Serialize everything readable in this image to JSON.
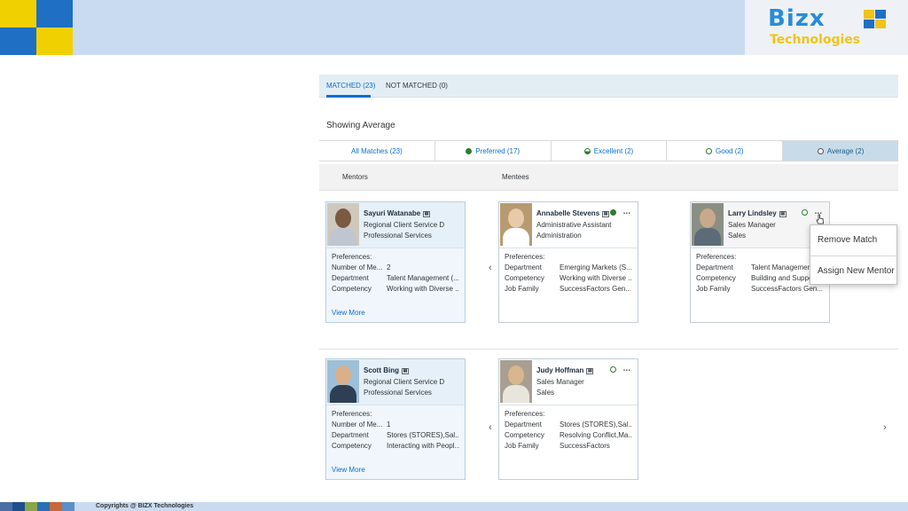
{
  "brand": {
    "name": "Bizx",
    "subtitle": "Technologies"
  },
  "tabs": [
    {
      "label": "MATCHED (23)",
      "active": true
    },
    {
      "label": "NOT MATCHED (0)",
      "active": false
    }
  ],
  "showing_label": "Showing Average",
  "filters": [
    {
      "label": "All Matches (23)",
      "icon": "none"
    },
    {
      "label": "Preferred (17)",
      "icon": "filled-circle-icon"
    },
    {
      "label": "Excellent (2)",
      "icon": "half-circle-icon"
    },
    {
      "label": "Good (2)",
      "icon": "ring-icon"
    },
    {
      "label": "Average (2)",
      "icon": "ring-icon",
      "selected": true
    }
  ],
  "columns": {
    "mentors": "Mentors",
    "mentees": "Mentees"
  },
  "row1": {
    "mentor": {
      "name": "Sayuri Watanabe",
      "title": "Regional Client Service D",
      "department": "Professional Services",
      "preferences_label": "Preferences:",
      "prefs": [
        {
          "k": "Number of Me...",
          "v": "2"
        },
        {
          "k": "Department",
          "v": "Talent Management (..."
        },
        {
          "k": "Competency",
          "v": "Working with Diverse ..."
        }
      ],
      "view_more": "View More"
    },
    "mentee_left": {
      "name": "Annabelle Stevens",
      "title": "Administrative Assistant",
      "department": "Administration",
      "preferences_label": "Preferences:",
      "prefs": [
        {
          "k": "Department",
          "v": "Emerging Markets (S..."
        },
        {
          "k": "Competency",
          "v": "Working with Diverse ..."
        },
        {
          "k": "Job Family",
          "v": "SuccessFactors Gen..."
        }
      ],
      "more": "..."
    },
    "mentee_right": {
      "name": "Larry Lindsley",
      "title": "Sales Manager",
      "department": "Sales",
      "preferences_label": "Preferences:",
      "prefs": [
        {
          "k": "Department",
          "v": "Talent Management"
        },
        {
          "k": "Competency",
          "v": "Building and Suppor"
        },
        {
          "k": "Job Family",
          "v": "SuccessFactors Gen..."
        }
      ],
      "more": "..."
    }
  },
  "row2": {
    "mentor": {
      "name": "Scott Bing",
      "title": "Regional Client Service D",
      "department": "Professional Services",
      "preferences_label": "Preferences:",
      "prefs": [
        {
          "k": "Number of Me...",
          "v": "1"
        },
        {
          "k": "Department",
          "v": "Stores (STORES),Sal..."
        },
        {
          "k": "Competency",
          "v": "Interacting with Peopl..."
        }
      ],
      "view_more": "View More"
    },
    "mentee_left": {
      "name": "Judy Hoffman",
      "title": "Sales Manager",
      "department": "Sales",
      "preferences_label": "Preferences:",
      "prefs": [
        {
          "k": "Department",
          "v": "Stores (STORES),Sal..."
        },
        {
          "k": "Competency",
          "v": "Resolving Conflict,Ma..."
        },
        {
          "k": "Job Family",
          "v": "SuccessFactors"
        }
      ],
      "more": "..."
    }
  },
  "arrows": {
    "prev": "‹",
    "next": "›"
  },
  "menu": {
    "items": [
      "Remove Match",
      "Assign New Mentor"
    ]
  },
  "footer": {
    "text": "Copyrights @ BIZX Technologies"
  },
  "colors": {
    "accent": "#0a6ed1",
    "status_green": "#2b7d2b",
    "header_bg": "#c9dbf0"
  }
}
